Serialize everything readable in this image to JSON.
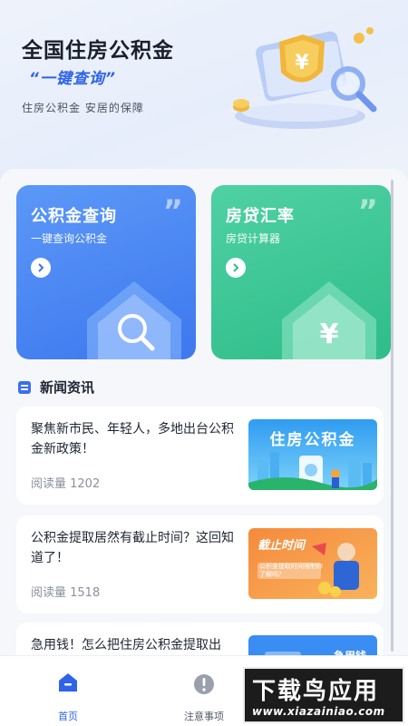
{
  "hero": {
    "title": "全国住房公积金",
    "subtitle": "“一键查询”",
    "tagline": "住房公积金 安居的保障"
  },
  "cards": [
    {
      "title": "公积金查询",
      "subtitle": "一键查询公积金",
      "icon": "search-house-icon",
      "color": "#4a86f4"
    },
    {
      "title": "房贷汇率",
      "subtitle": "房贷计算器",
      "icon": "yuan-house-icon",
      "color": "#3cc795"
    }
  ],
  "news_section": {
    "title": "新闻资讯"
  },
  "news": [
    {
      "title": "聚焦新市民、年轻人，多地出台公积金新政策！",
      "reads": "阅读量 1202",
      "thumb_text": "住房公积金"
    },
    {
      "title": "公积金提取居然有截止时间？这回知道了！",
      "reads": "阅读量 1518",
      "thumb_text": "截止时间",
      "thumb_caption": "公积金提取时间限制你了解吗？"
    },
    {
      "title": "急用钱！怎么把住房公积金提取出来？",
      "thumb_text": "急用钱"
    }
  ],
  "tabbar": [
    {
      "label": "首页",
      "icon": "home-icon",
      "active": true
    },
    {
      "label": "注意事项",
      "icon": "alert-icon",
      "active": false
    }
  ],
  "watermark": {
    "main": "下载鸟应用",
    "sub": "www.xiazainiao.com"
  },
  "colors": {
    "accent": "#2f63e8",
    "blue_card": "#4a86f4",
    "green_card": "#3cc795"
  }
}
